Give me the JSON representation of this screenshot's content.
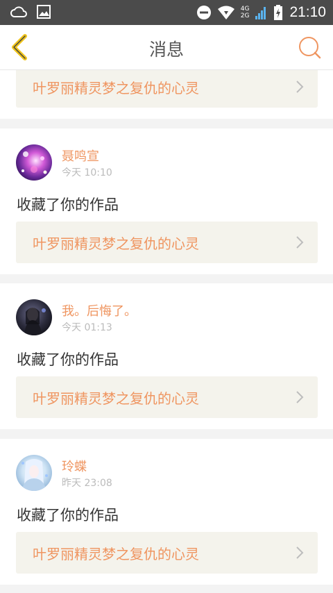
{
  "status_bar": {
    "time": "21:10",
    "network_top": "4G",
    "network_bottom": "2G"
  },
  "header": {
    "title": "消息"
  },
  "colors": {
    "accent": "#ef9560",
    "back_icon": "#f0c419",
    "status_bg": "#4b4b4b"
  },
  "partial_card": {
    "work_title": "叶罗丽精灵梦之复仇的心灵"
  },
  "messages": [
    {
      "username": "聂鸣宣",
      "time": "今天 10:10",
      "action": "收藏了你的作品",
      "work_title": "叶罗丽精灵梦之复仇的心灵"
    },
    {
      "username": "我。后悔了。",
      "time": "今天 01:13",
      "action": "收藏了你的作品",
      "work_title": "叶罗丽精灵梦之复仇的心灵"
    },
    {
      "username": "玲蝶",
      "time": "昨天 23:08",
      "action": "收藏了你的作品",
      "work_title": "叶罗丽精灵梦之复仇的心灵"
    }
  ]
}
